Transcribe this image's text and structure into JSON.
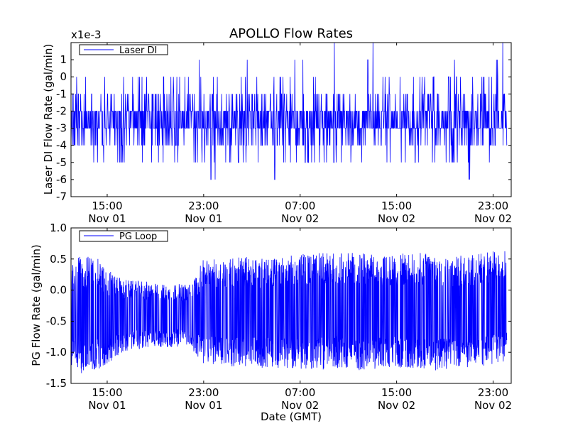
{
  "chart_data": [
    {
      "type": "line",
      "title": "APOLLO Flow Rates",
      "xlabel": "",
      "ylabel": "Laser DI Flow Rate (gal/min)",
      "offset_text": "x1e-3",
      "scale": 0.001,
      "ylim": [
        -7,
        2
      ],
      "yticks": [
        1,
        0,
        -1,
        -2,
        -3,
        -4,
        -5,
        -6,
        -7
      ],
      "x_range": [
        "2011-11-01 12:00",
        "2011-11-03 00:30"
      ],
      "x_ticks": [
        {
          "time": "15:00",
          "date": "Nov 01"
        },
        {
          "time": "23:00",
          "date": "Nov 01"
        },
        {
          "time": "07:00",
          "date": "Nov 02"
        },
        {
          "time": "15:00",
          "date": "Nov 02"
        },
        {
          "time": "23:00",
          "date": "Nov 02"
        }
      ],
      "x_tick_times": [
        "2011-11-01 15:00",
        "2011-11-01 23:00",
        "2011-11-02 07:00",
        "2011-11-02 15:00",
        "2011-11-02 23:00"
      ],
      "legend": {
        "placement": "upper-left",
        "entries": [
          "Laser DI"
        ]
      },
      "grid": false,
      "series": [
        {
          "name": "Laser DI",
          "color": "#0000ff",
          "description": "noisy signal mostly between -4 and -1 (x1e-3), concentrated around -2 to -3, with occasional spikes up to 2 and down to -7",
          "samples": [
            {
              "time": "2011-11-01 12:10",
              "min": -5,
              "max": 0
            },
            {
              "time": "2011-11-01 13:00",
              "min": -4,
              "max": 0
            },
            {
              "time": "2011-11-01 14:00",
              "min": -5,
              "max": 0
            },
            {
              "time": "2011-11-01 15:00",
              "min": -4,
              "max": 0
            },
            {
              "time": "2011-11-01 16:00",
              "min": -5,
              "max": 0
            },
            {
              "time": "2011-11-01 17:00",
              "min": -4,
              "max": 0
            },
            {
              "time": "2011-11-01 18:00",
              "min": -5,
              "max": 0
            },
            {
              "time": "2011-11-01 19:00",
              "min": -6,
              "max": 1
            },
            {
              "time": "2011-11-01 20:00",
              "min": -4,
              "max": 0
            },
            {
              "time": "2011-11-01 21:00",
              "min": -5,
              "max": 0
            },
            {
              "time": "2011-11-01 22:00",
              "min": -5,
              "max": 0
            },
            {
              "time": "2011-11-01 23:00",
              "min": -5,
              "max": 2
            },
            {
              "time": "2011-11-02 00:00",
              "min": -6,
              "max": 0
            },
            {
              "time": "2011-11-02 01:00",
              "min": -5,
              "max": 0
            },
            {
              "time": "2011-11-02 02:00",
              "min": -5,
              "max": 2
            },
            {
              "time": "2011-11-02 03:00",
              "min": -6,
              "max": 0
            },
            {
              "time": "2011-11-02 04:00",
              "min": -7,
              "max": 1
            },
            {
              "time": "2011-11-02 05:00",
              "min": -6,
              "max": 0
            },
            {
              "time": "2011-11-02 06:00",
              "min": -5,
              "max": 0
            },
            {
              "time": "2011-11-02 07:00",
              "min": -5,
              "max": 1
            },
            {
              "time": "2011-11-02 08:00",
              "min": -5,
              "max": 0
            },
            {
              "time": "2011-11-02 09:00",
              "min": -5,
              "max": 0
            },
            {
              "time": "2011-11-02 10:00",
              "min": -5,
              "max": 2
            },
            {
              "time": "2011-11-02 11:00",
              "min": -5,
              "max": 0
            },
            {
              "time": "2011-11-02 12:00",
              "min": -5,
              "max": 0
            },
            {
              "time": "2011-11-02 13:00",
              "min": -6,
              "max": 2
            },
            {
              "time": "2011-11-02 14:00",
              "min": -5,
              "max": 0
            },
            {
              "time": "2011-11-02 15:00",
              "min": -5,
              "max": 1
            },
            {
              "time": "2011-11-02 16:00",
              "min": -5,
              "max": 0
            },
            {
              "time": "2011-11-02 17:00",
              "min": -5,
              "max": 0
            },
            {
              "time": "2011-11-02 18:00",
              "min": -5,
              "max": 0
            },
            {
              "time": "2011-11-02 19:00",
              "min": -6,
              "max": 0
            },
            {
              "time": "2011-11-02 20:00",
              "min": -5,
              "max": 1
            },
            {
              "time": "2011-11-02 21:00",
              "min": -6,
              "max": 0
            },
            {
              "time": "2011-11-02 22:00",
              "min": -6,
              "max": 0
            },
            {
              "time": "2011-11-02 23:00",
              "min": -5,
              "max": 0
            },
            {
              "time": "2011-11-03 00:00",
              "min": -5,
              "max": 2
            }
          ]
        }
      ]
    },
    {
      "type": "line",
      "title": "",
      "xlabel": "Date (GMT)",
      "ylabel": "PG Flow Rate (gal/min)",
      "ylim": [
        -1.5,
        1.0
      ],
      "yticks": [
        1.0,
        0.5,
        0.0,
        -0.5,
        -1.0,
        -1.5
      ],
      "ytick_labels": [
        "1.0",
        "0.5",
        "0.0",
        "-0.5",
        "-1.0",
        "-1.5"
      ],
      "x_range": [
        "2011-11-01 12:00",
        "2011-11-03 00:30"
      ],
      "x_ticks": [
        {
          "time": "15:00",
          "date": "Nov 01"
        },
        {
          "time": "23:00",
          "date": "Nov 01"
        },
        {
          "time": "07:00",
          "date": "Nov 02"
        },
        {
          "time": "15:00",
          "date": "Nov 02"
        },
        {
          "time": "23:00",
          "date": "Nov 02"
        }
      ],
      "x_tick_times": [
        "2011-11-01 15:00",
        "2011-11-01 23:00",
        "2011-11-02 07:00",
        "2011-11-02 15:00",
        "2011-11-02 23:00"
      ],
      "legend": {
        "placement": "upper-left",
        "entries": [
          "PG Loop"
        ]
      },
      "grid": false,
      "series": [
        {
          "name": "PG Loop",
          "color": "#0000ff",
          "description": "dense oscillating band; envelope roughly -1.35 to 0.55 early, narrowing to about -1.0 to 0.1 around 16:00-23:00 Nov 01, then -1.25 to 0.6 afterwards",
          "samples": [
            {
              "time": "2011-11-01 12:00",
              "min": -1.25,
              "max": 0.5
            },
            {
              "time": "2011-11-01 13:00",
              "min": -1.35,
              "max": 0.55
            },
            {
              "time": "2011-11-01 14:00",
              "min": -1.3,
              "max": 0.55
            },
            {
              "time": "2011-11-01 15:00",
              "min": -1.2,
              "max": 0.35
            },
            {
              "time": "2011-11-01 16:00",
              "min": -1.05,
              "max": 0.2
            },
            {
              "time": "2011-11-01 17:00",
              "min": -0.95,
              "max": 0.15
            },
            {
              "time": "2011-11-01 18:00",
              "min": -0.95,
              "max": 0.15
            },
            {
              "time": "2011-11-01 19:00",
              "min": -0.9,
              "max": 0.1
            },
            {
              "time": "2011-11-01 20:00",
              "min": -0.95,
              "max": 0.1
            },
            {
              "time": "2011-11-01 21:00",
              "min": -0.9,
              "max": 0.1
            },
            {
              "time": "2011-11-01 22:00",
              "min": -0.95,
              "max": 0.1
            },
            {
              "time": "2011-11-01 23:00",
              "min": -1.2,
              "max": 0.5
            },
            {
              "time": "2011-11-02 00:00",
              "min": -1.2,
              "max": 0.5
            },
            {
              "time": "2011-11-02 02:00",
              "min": -1.25,
              "max": 0.55
            },
            {
              "time": "2011-11-02 04:00",
              "min": -1.25,
              "max": 0.5
            },
            {
              "time": "2011-11-02 06:00",
              "min": -1.25,
              "max": 0.55
            },
            {
              "time": "2011-11-02 08:00",
              "min": -1.3,
              "max": 0.6
            },
            {
              "time": "2011-11-02 10:00",
              "min": -1.25,
              "max": 0.6
            },
            {
              "time": "2011-11-02 12:00",
              "min": -1.3,
              "max": 0.6
            },
            {
              "time": "2011-11-02 14:00",
              "min": -1.25,
              "max": 0.55
            },
            {
              "time": "2011-11-02 16:00",
              "min": -1.25,
              "max": 0.6
            },
            {
              "time": "2011-11-02 18:00",
              "min": -1.3,
              "max": 0.6
            },
            {
              "time": "2011-11-02 20:00",
              "min": -1.25,
              "max": 0.55
            },
            {
              "time": "2011-11-02 22:00",
              "min": -1.25,
              "max": 0.6
            },
            {
              "time": "2011-11-03 00:00",
              "min": -1.15,
              "max": 0.65
            }
          ]
        }
      ]
    }
  ]
}
